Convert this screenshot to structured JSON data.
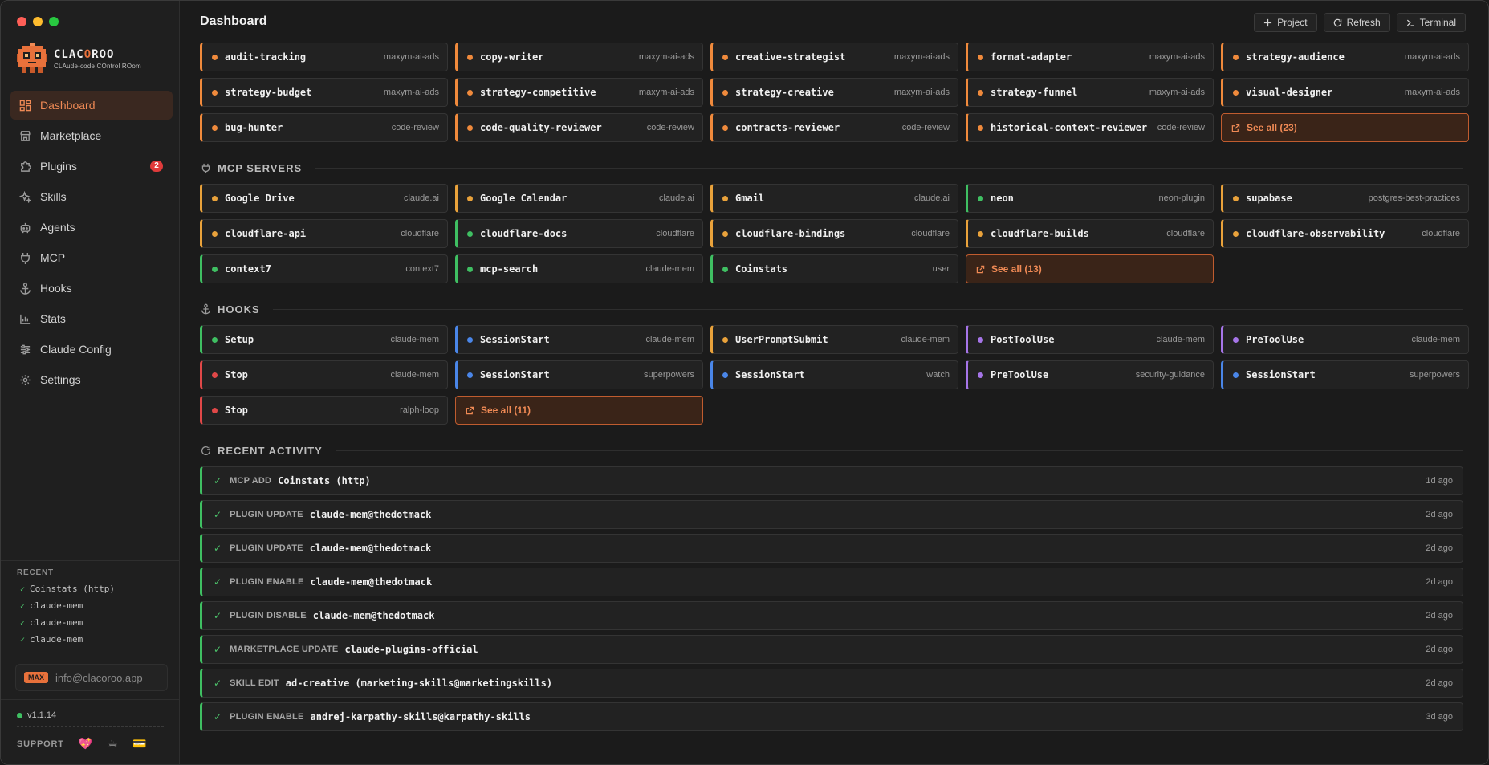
{
  "colors": {
    "accent": "#e8713b",
    "orange": "#f08a3c",
    "green": "#3fbf62",
    "amber": "#e9a23b",
    "blue": "#4a86e8",
    "purple": "#a675e8",
    "red": "#e04848"
  },
  "app": {
    "name_prefix": "CLAC",
    "name_highlight": "O",
    "name_suffix": "ROO",
    "tagline": "CLAude-code COntrol ROom"
  },
  "sidebar": {
    "items": [
      {
        "label": "Dashboard",
        "icon": "dashboard-icon",
        "active": true
      },
      {
        "label": "Marketplace",
        "icon": "store-icon"
      },
      {
        "label": "Plugins",
        "icon": "puzzle-icon",
        "badge": "2"
      },
      {
        "label": "Skills",
        "icon": "sparkle-icon"
      },
      {
        "label": "Agents",
        "icon": "robot-icon"
      },
      {
        "label": "MCP",
        "icon": "plug-icon"
      },
      {
        "label": "Hooks",
        "icon": "anchor-icon"
      },
      {
        "label": "Stats",
        "icon": "bar-chart-icon"
      },
      {
        "label": "Claude Config",
        "icon": "sliders-icon"
      },
      {
        "label": "Settings",
        "icon": "gear-icon"
      }
    ],
    "recent_title": "RECENT",
    "recent": [
      "Coinstats (http)",
      "claude-mem",
      "claude-mem",
      "claude-mem"
    ],
    "plan_badge": "MAX",
    "email": "info@clacoroo.app",
    "version": "v1.1.14",
    "support_label": "SUPPORT"
  },
  "header": {
    "title": "Dashboard",
    "buttons": [
      {
        "label": "Project",
        "icon": "plus-icon"
      },
      {
        "label": "Refresh",
        "icon": "refresh-icon"
      },
      {
        "label": "Terminal",
        "icon": "terminal-icon"
      }
    ]
  },
  "agents": {
    "items": [
      {
        "name": "audit-tracking",
        "source": "maxym-ai-ads"
      },
      {
        "name": "copy-writer",
        "source": "maxym-ai-ads"
      },
      {
        "name": "creative-strategist",
        "source": "maxym-ai-ads"
      },
      {
        "name": "format-adapter",
        "source": "maxym-ai-ads"
      },
      {
        "name": "strategy-audience",
        "source": "maxym-ai-ads"
      },
      {
        "name": "strategy-budget",
        "source": "maxym-ai-ads"
      },
      {
        "name": "strategy-competitive",
        "source": "maxym-ai-ads"
      },
      {
        "name": "strategy-creative",
        "source": "maxym-ai-ads"
      },
      {
        "name": "strategy-funnel",
        "source": "maxym-ai-ads"
      },
      {
        "name": "visual-designer",
        "source": "maxym-ai-ads"
      },
      {
        "name": "bug-hunter",
        "source": "code-review"
      },
      {
        "name": "code-quality-reviewer",
        "source": "code-review"
      },
      {
        "name": "contracts-reviewer",
        "source": "code-review"
      },
      {
        "name": "historical-context-reviewer",
        "source": "code-review"
      }
    ],
    "see_all": "See all (23)"
  },
  "mcp": {
    "title": "MCP SERVERS",
    "items": [
      {
        "name": "Google Drive",
        "source": "claude.ai",
        "status": "amber"
      },
      {
        "name": "Google Calendar",
        "source": "claude.ai",
        "status": "amber"
      },
      {
        "name": "Gmail",
        "source": "claude.ai",
        "status": "amber"
      },
      {
        "name": "neon",
        "source": "neon-plugin",
        "status": "green"
      },
      {
        "name": "supabase",
        "source": "postgres-best-practices",
        "status": "amber"
      },
      {
        "name": "cloudflare-api",
        "source": "cloudflare",
        "status": "amber"
      },
      {
        "name": "cloudflare-docs",
        "source": "cloudflare",
        "status": "green"
      },
      {
        "name": "cloudflare-bindings",
        "source": "cloudflare",
        "status": "amber"
      },
      {
        "name": "cloudflare-builds",
        "source": "cloudflare",
        "status": "amber"
      },
      {
        "name": "cloudflare-observability",
        "source": "cloudflare",
        "status": "amber"
      },
      {
        "name": "context7",
        "source": "context7",
        "status": "green"
      },
      {
        "name": "mcp-search",
        "source": "claude-mem",
        "status": "green"
      },
      {
        "name": "Coinstats",
        "source": "user",
        "status": "green"
      }
    ],
    "see_all": "See all (13)"
  },
  "hooks": {
    "title": "HOOKS",
    "items": [
      {
        "name": "Setup",
        "source": "claude-mem",
        "status": "green"
      },
      {
        "name": "SessionStart",
        "source": "claude-mem",
        "status": "blue"
      },
      {
        "name": "UserPromptSubmit",
        "source": "claude-mem",
        "status": "amber"
      },
      {
        "name": "PostToolUse",
        "source": "claude-mem",
        "status": "purple"
      },
      {
        "name": "PreToolUse",
        "source": "claude-mem",
        "status": "purple"
      },
      {
        "name": "Stop",
        "source": "claude-mem",
        "status": "red"
      },
      {
        "name": "SessionStart",
        "source": "superpowers",
        "status": "blue"
      },
      {
        "name": "SessionStart",
        "source": "watch",
        "status": "blue"
      },
      {
        "name": "PreToolUse",
        "source": "security-guidance",
        "status": "purple"
      },
      {
        "name": "SessionStart",
        "source": "superpowers",
        "status": "blue"
      },
      {
        "name": "Stop",
        "source": "ralph-loop",
        "status": "red"
      }
    ],
    "see_all": "See all (11)"
  },
  "activity": {
    "title": "RECENT ACTIVITY",
    "items": [
      {
        "type": "MCP ADD",
        "name": "Coinstats (http)",
        "time": "1d ago"
      },
      {
        "type": "PLUGIN UPDATE",
        "name": "claude-mem@thedotmack",
        "time": "2d ago"
      },
      {
        "type": "PLUGIN UPDATE",
        "name": "claude-mem@thedotmack",
        "time": "2d ago"
      },
      {
        "type": "PLUGIN ENABLE",
        "name": "claude-mem@thedotmack",
        "time": "2d ago"
      },
      {
        "type": "PLUGIN DISABLE",
        "name": "claude-mem@thedotmack",
        "time": "2d ago"
      },
      {
        "type": "MARKETPLACE UPDATE",
        "name": "claude-plugins-official",
        "time": "2d ago"
      },
      {
        "type": "SKILL EDIT",
        "name": "ad-creative (marketing-skills@marketingskills)",
        "time": "2d ago"
      },
      {
        "type": "PLUGIN ENABLE",
        "name": "andrej-karpathy-skills@karpathy-skills",
        "time": "3d ago"
      }
    ]
  }
}
